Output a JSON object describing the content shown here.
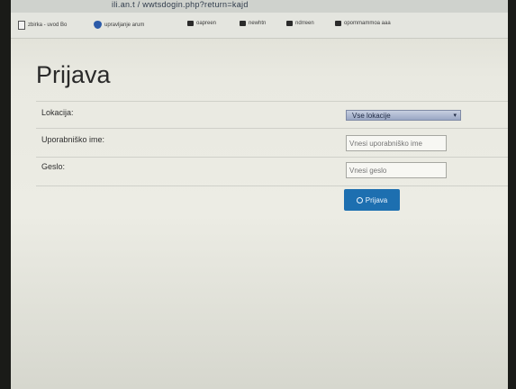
{
  "browser": {
    "url": "ili.an.t / wwtsdogin.php?return=kajd"
  },
  "bookmarks": [
    {
      "label": "zbirka - uvod Bo",
      "icon": "page-icon"
    },
    {
      "label": "upravljanje arum",
      "icon": "shield-icon"
    },
    {
      "label": "oapreen",
      "icon": "folder-icon"
    },
    {
      "label": "newhtn",
      "icon": "folder-icon"
    },
    {
      "label": "ndrreen",
      "icon": "folder-icon"
    },
    {
      "label": "opommammoa aaa",
      "icon": "folder-icon"
    }
  ],
  "page": {
    "title": "Prijava",
    "location_label": "Lokacija:",
    "location_value": "Vse lokacije",
    "username_label": "Uporabniško ime:",
    "username_placeholder": "Vnesi uporabniško ime",
    "password_label": "Geslo:",
    "password_placeholder": "Vnesi geslo",
    "login_button": "Prijava"
  }
}
